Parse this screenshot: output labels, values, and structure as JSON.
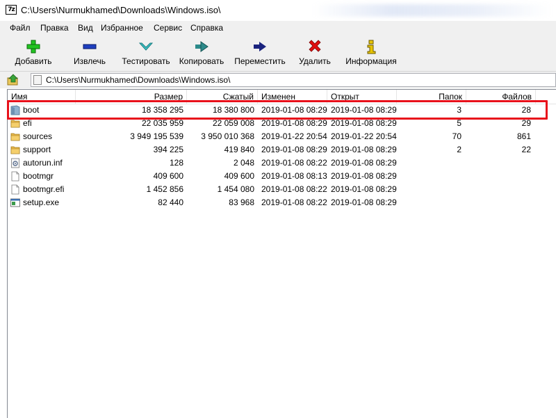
{
  "window": {
    "app_icon_text": "7z",
    "title": "C:\\Users\\Nurmukhamed\\Downloads\\Windows.iso\\"
  },
  "menu": [
    "Файл",
    "Правка",
    "Вид",
    "Избранное",
    "Сервис",
    "Справка"
  ],
  "toolbar": {
    "buttons": [
      {
        "label": "Добавить",
        "icon": "plus-icon",
        "color": "#22c322"
      },
      {
        "label": "Извлечь",
        "icon": "minus-icon",
        "color": "#1f3fbf"
      },
      {
        "label": "Тестировать",
        "icon": "check-icon",
        "color": "#3fc6c8"
      },
      {
        "label": "Копировать",
        "icon": "copy-arrow-icon",
        "color": "#2c8a8a"
      },
      {
        "label": "Переместить",
        "icon": "move-arrow-icon",
        "color": "#1a237e"
      },
      {
        "label": "Удалить",
        "icon": "delete-x-icon",
        "color": "#e01010"
      },
      {
        "label": "Информация",
        "icon": "info-icon",
        "color": "#e8c400"
      }
    ]
  },
  "address": {
    "path": "C:\\Users\\Nurmukhamed\\Downloads\\Windows.iso\\"
  },
  "columns": [
    "Имя",
    "Размер",
    "Сжатый",
    "Изменен",
    "Открыт",
    "Папок",
    "Файлов"
  ],
  "files": [
    {
      "name": "boot",
      "type": "folder-special",
      "size": "18 358 295",
      "packed": "18 380 800",
      "modified": "2019-01-08 08:29",
      "opened": "2019-01-08 08:29",
      "folders": "3",
      "files": "28"
    },
    {
      "name": "efi",
      "type": "folder",
      "size": "22 035 959",
      "packed": "22 059 008",
      "modified": "2019-01-08 08:29",
      "opened": "2019-01-08 08:29",
      "folders": "5",
      "files": "29"
    },
    {
      "name": "sources",
      "type": "folder",
      "size": "3 949 195 539",
      "packed": "3 950 010 368",
      "modified": "2019-01-22 20:54",
      "opened": "2019-01-22 20:54",
      "folders": "70",
      "files": "861"
    },
    {
      "name": "support",
      "type": "folder",
      "size": "394 225",
      "packed": "419 840",
      "modified": "2019-01-08 08:29",
      "opened": "2019-01-08 08:29",
      "folders": "2",
      "files": "22"
    },
    {
      "name": "autorun.inf",
      "type": "config",
      "size": "128",
      "packed": "2 048",
      "modified": "2019-01-08 08:22",
      "opened": "2019-01-08 08:29",
      "folders": "",
      "files": ""
    },
    {
      "name": "bootmgr",
      "type": "file",
      "size": "409 600",
      "packed": "409 600",
      "modified": "2019-01-08 08:13",
      "opened": "2019-01-08 08:29",
      "folders": "",
      "files": ""
    },
    {
      "name": "bootmgr.efi",
      "type": "file",
      "size": "1 452 856",
      "packed": "1 454 080",
      "modified": "2019-01-08 08:22",
      "opened": "2019-01-08 08:29",
      "folders": "",
      "files": ""
    },
    {
      "name": "setup.exe",
      "type": "exe",
      "size": "82 440",
      "packed": "83 968",
      "modified": "2019-01-08 08:22",
      "opened": "2019-01-08 08:29",
      "folders": "",
      "files": ""
    }
  ],
  "colors": {
    "highlight": "#e8111b",
    "folder": "#e8b84a",
    "folder_special": "#8fb1cf"
  }
}
